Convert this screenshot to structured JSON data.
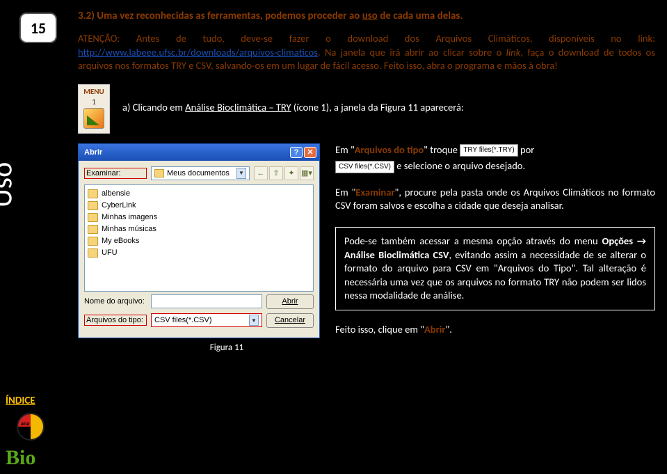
{
  "page_number": "15",
  "rotated_label": "Uso",
  "indice_link": "ÍNDICE",
  "heading": {
    "prefix": "3.2) Uma vez reconhecidas as ferramentas, podemos proceder ao ",
    "underlined": "uso",
    "suffix": " de cada uma delas."
  },
  "intro_para": {
    "t1": "ATENÇÃO: Antes de tudo, deve-se fazer o download dos Arquivos Climáticos, disponíveis no link: ",
    "link": "http://www.labeee.ufsc.br/downloads/arquivos-climaticos",
    "t2": ". Na janela que irá abrir ao clicar sobre o ",
    "italic": "link",
    "t3": ", faça o download de todos os arquivos nos formatos TRY e CSV, salvando-os em um lugar de fácil acesso. Feito isso, abra o programa e mãos à obra!"
  },
  "menu": {
    "label": "MENU",
    "number": "1",
    "text_pre": "a) Clicando em ",
    "text_u": "Análise Bioclimática – TRY",
    "text_post": " (ícone 1), a janela da Figura  11 aparecerá:"
  },
  "dialog": {
    "title": "Abrir",
    "help": "?",
    "close": "✕",
    "examinar_label": "Examinar:",
    "examinar_value": "Meus documentos",
    "files": [
      "albensie",
      "CyberLink",
      "Minhas imagens",
      "Minhas músicas",
      "My eBooks",
      "UFU"
    ],
    "nome_label": "Nome do arquivo:",
    "tipo_label": "Arquivos do tipo:",
    "tipo_value": "CSV files(*.CSV)",
    "btn_abrir": "Abrir",
    "btn_cancelar": "Cancelar",
    "toolbar_icons": [
      "←",
      "⇧",
      "✦",
      "▦▾"
    ]
  },
  "figure_caption": "Figura 11",
  "right": {
    "line1_a": "Em \"",
    "line1_b": "Arquivos do tipo",
    "line1_c": "\" troque",
    "pill_try": "TRY files(*.TRY)",
    "line1_d": "por",
    "pill_csv": "CSV files(*.CSV)",
    "line1_e": " e selecione o arquivo desejado.",
    "p2_a": "Em \"",
    "p2_b": "Examinar",
    "p2_c": "\", procure pela pasta onde os Arquivos Climáticos no formato CSV foram salvos e escolha a cidade que deseja analisar.",
    "box_a": "Pode-se também acessar a mesma opção através do menu ",
    "box_b": "Opções → Análise Bioclimática CSV",
    "box_c": ", evitando assim a necessidade de se alterar o formato do arquivo  para CSV em \"Arquivos do Tipo\". Tal alteração é necessária uma vez que os arquivos no formato TRY não podem ser lidos nessa modalidade de análise.",
    "final_a": "Feito isso, clique em \"",
    "final_b": "Abrir",
    "final_c": "\"."
  }
}
